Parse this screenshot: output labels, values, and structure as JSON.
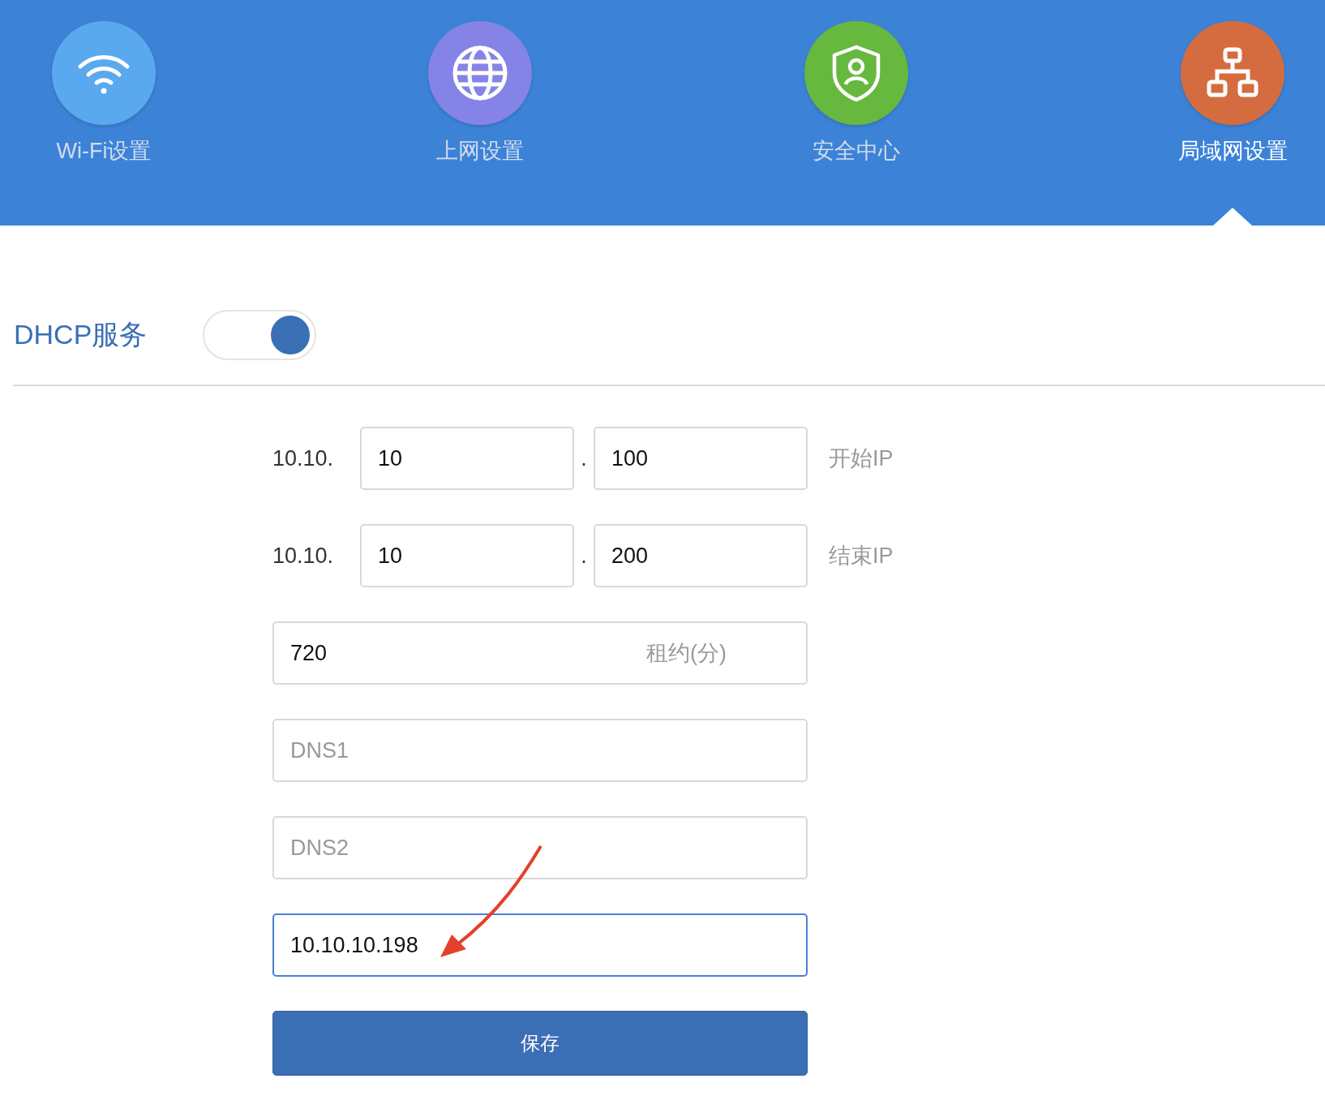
{
  "tabs": [
    {
      "label": "Wi-Fi设置",
      "kind": "wifi",
      "color": "#5aa9ee",
      "selected": false
    },
    {
      "label": "上网设置",
      "kind": "globe",
      "color": "#8584e6",
      "selected": false
    },
    {
      "label": "安全中心",
      "kind": "shield",
      "color": "#67b83f",
      "selected": false
    },
    {
      "label": "局域网设置",
      "kind": "network",
      "color": "#d56c3f",
      "selected": true
    }
  ],
  "dhcp": {
    "label": "DHCP服务",
    "on": true
  },
  "ip_ranges": [
    {
      "prefix": "10.10.",
      "part_1": "10",
      "separator": ".",
      "part_2": "100",
      "label": "开始IP"
    },
    {
      "prefix": "10.10.",
      "part_1": "10",
      "separator": ".",
      "part_2": "200",
      "label": "结束IP"
    }
  ],
  "lease": {
    "value": "720",
    "label": "租约(分)"
  },
  "fields": [
    {
      "placeholder": "DNS1",
      "focused": false
    },
    {
      "placeholder": "DNS2",
      "focused": false
    },
    {
      "value": "10.10.10.198",
      "focused": true
    }
  ],
  "save_button": "保存"
}
